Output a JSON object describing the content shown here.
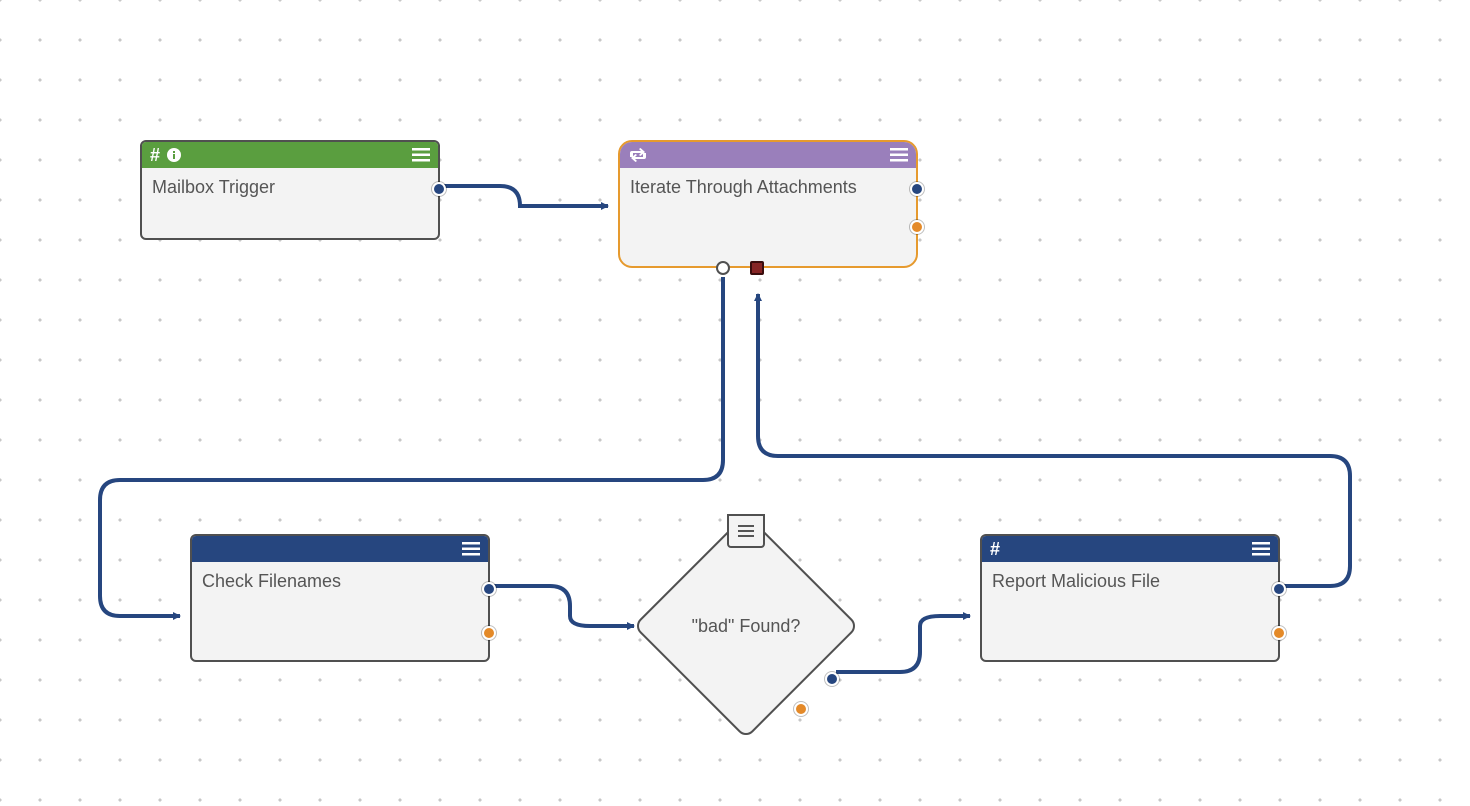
{
  "colors": {
    "edge": "#26467f",
    "header_green": "#5a9e3f",
    "header_purple": "#9a7fbb",
    "header_blue": "#26467f",
    "node_bg": "#f3f3f3",
    "node_border": "#505050",
    "selected_border": "#e69a2e",
    "port_blue": "#26467f",
    "port_orange": "#e48a29",
    "port_error": "#862525"
  },
  "nodes": {
    "mailbox_trigger": {
      "label": "Mailbox Trigger",
      "header_color": "green",
      "icons": [
        "hash",
        "info"
      ],
      "selected": false
    },
    "iterate_attachments": {
      "label": "Iterate Through Attachments",
      "header_color": "purple",
      "icons": [
        "retweet"
      ],
      "selected": true
    },
    "check_filenames": {
      "label": "Check Filenames",
      "header_color": "blue",
      "icons": [],
      "selected": false
    },
    "report_malicious": {
      "label": "Report Malicious File",
      "header_color": "blue",
      "icons": [
        "hash"
      ],
      "selected": false
    },
    "decision": {
      "label": "\"bad\" Found?",
      "type": "decision"
    }
  },
  "edges": [
    {
      "from": "mailbox_trigger",
      "to": "iterate_attachments"
    },
    {
      "from": "iterate_attachments",
      "to": "check_filenames"
    },
    {
      "from": "check_filenames",
      "to": "decision"
    },
    {
      "from": "decision",
      "to": "report_malicious"
    },
    {
      "from": "report_malicious",
      "to": "iterate_attachments"
    }
  ]
}
